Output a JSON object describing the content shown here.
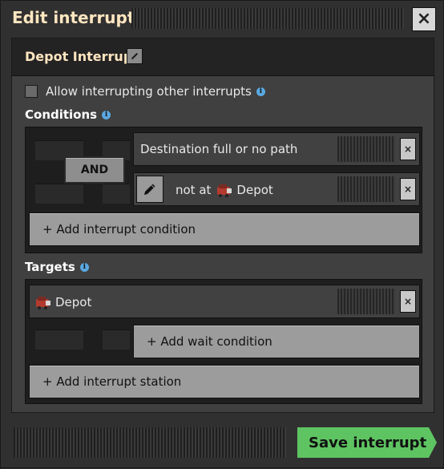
{
  "window": {
    "title": "Edit interrupt",
    "close_icon": "×"
  },
  "interrupt": {
    "name": "Depot Interrupt",
    "allow_interrupting_label": "Allow interrupting other interrupts",
    "allow_interrupting_checked": false
  },
  "conditions": {
    "heading": "Conditions",
    "logic_operator": "AND",
    "items": [
      {
        "text": "Destination full or no path"
      },
      {
        "prefix": "not at",
        "station": "Depot"
      }
    ],
    "add_label": "+ Add interrupt condition"
  },
  "targets": {
    "heading": "Targets",
    "station": "Depot",
    "add_wait_label": "+ Add wait condition",
    "add_station_label": "+ Add interrupt station"
  },
  "footer": {
    "save_label": "Save interrupt"
  },
  "colors": {
    "title": "#ffe6c0",
    "info": "#5aa8e0",
    "save": "#5ec462"
  },
  "icons": {
    "info": "info-icon",
    "close": "close-icon",
    "pencil": "pencil-icon",
    "train": "train-stop-icon"
  }
}
